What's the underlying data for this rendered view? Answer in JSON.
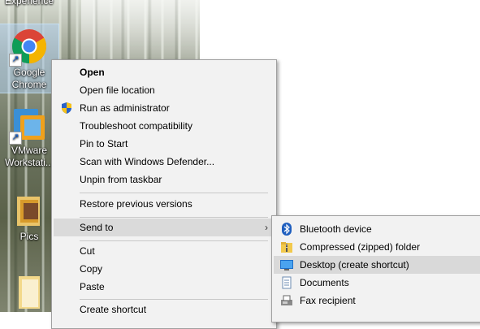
{
  "desktop": {
    "partial_top_label": "Experience",
    "icons": [
      {
        "label": "Google Chrome",
        "line1": "Google",
        "line2": "Chrome"
      },
      {
        "label": "VMware Workstation",
        "line1": "VMware",
        "line2": "Workstati..."
      },
      {
        "label": "Pics",
        "line1": "Pics",
        "line2": ""
      }
    ]
  },
  "context_menu": {
    "items": [
      {
        "label": "Open",
        "bold": true
      },
      {
        "label": "Open file location"
      },
      {
        "label": "Run as administrator",
        "icon": "uac-shield-icon"
      },
      {
        "label": "Troubleshoot compatibility"
      },
      {
        "label": "Pin to Start"
      },
      {
        "label": "Scan with Windows Defender..."
      },
      {
        "label": "Unpin from taskbar"
      },
      {
        "label": "Restore previous versions"
      },
      {
        "label": "Send to",
        "submenu": true,
        "highlighted": true
      },
      {
        "label": "Cut"
      },
      {
        "label": "Copy"
      },
      {
        "label": "Paste"
      },
      {
        "label": "Create shortcut"
      }
    ]
  },
  "send_to_menu": {
    "items": [
      {
        "label": "Bluetooth device",
        "icon": "bluetooth-icon"
      },
      {
        "label": "Compressed (zipped) folder",
        "icon": "zip-folder-icon"
      },
      {
        "label": "Desktop (create shortcut)",
        "icon": "desktop-icon",
        "highlighted": true
      },
      {
        "label": "Documents",
        "icon": "documents-icon"
      },
      {
        "label": "Fax recipient",
        "icon": "fax-icon"
      }
    ]
  },
  "colors": {
    "menu_bg": "#f2f2f2",
    "highlight": "#dadada",
    "chrome_red": "#db4437",
    "chrome_green": "#0f9d58",
    "chrome_yellow": "#f4b400",
    "chrome_blue": "#4285f4"
  }
}
